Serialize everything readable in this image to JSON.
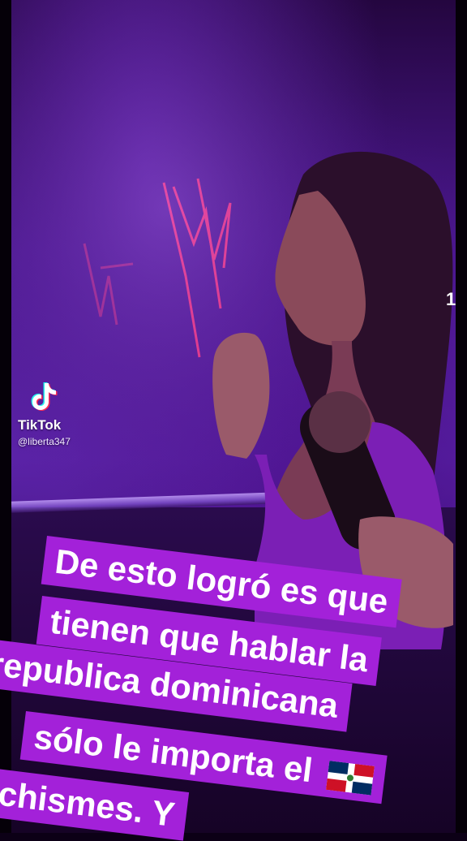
{
  "watermark": {
    "brand": "TikTok",
    "handle": "@liberta347",
    "logo_icon": "tiktok-note-icon"
  },
  "edge_text": "1",
  "caption": {
    "lines": [
      "De esto logró es que",
      "tienen que hablar la",
      "republica dominicana",
      "sólo le importa el",
      "chismes. Y"
    ],
    "flag_icon": "dominican-flag-icon",
    "bg_color": "#a321d9",
    "text_color": "#ffffff"
  },
  "colors": {
    "stage_purple": "#5a23a8",
    "neon_pink": "#ff3d8a",
    "outfit_purple": "#7b1fb5"
  }
}
